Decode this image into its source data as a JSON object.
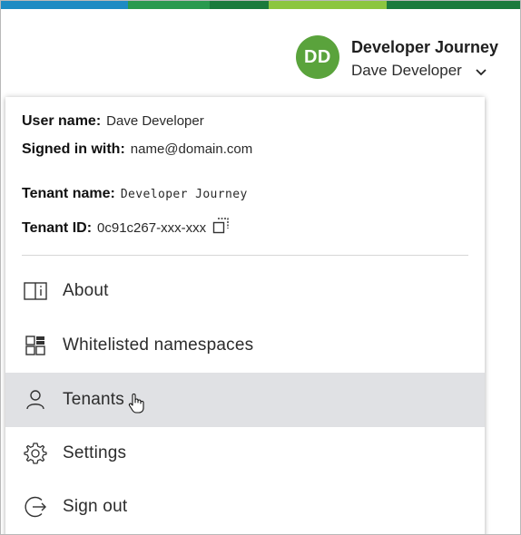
{
  "colors": {
    "strip": [
      "#1e8bc3",
      "#2a9a4f",
      "#1a7a3c",
      "#8cc63f",
      "#1a7a3c",
      "#5aa33c"
    ],
    "avatar_bg": "#5aa33c",
    "active_bg": "#e0e1e4"
  },
  "header": {
    "avatar_initials": "DD",
    "tenant_name": "Developer Journey",
    "user_name": "Dave Developer"
  },
  "account": {
    "user_label": "User name:",
    "user_value": "Dave Developer",
    "signin_label": "Signed in with:",
    "signin_value": "name@domain.com",
    "tenant_label": "Tenant name:",
    "tenant_value": "Developer Journey",
    "tenant_id_label": "Tenant ID:",
    "tenant_id_value": "0c91c267-xxx-xxx"
  },
  "menu": {
    "items": [
      {
        "label": "About",
        "icon": "book-info-icon"
      },
      {
        "label": "Whitelisted namespaces",
        "icon": "namespace-grid-icon"
      },
      {
        "label": "Tenants",
        "icon": "person-icon",
        "active": true
      },
      {
        "label": "Settings",
        "icon": "gear-icon"
      },
      {
        "label": "Sign out",
        "icon": "sign-out-icon"
      }
    ]
  }
}
